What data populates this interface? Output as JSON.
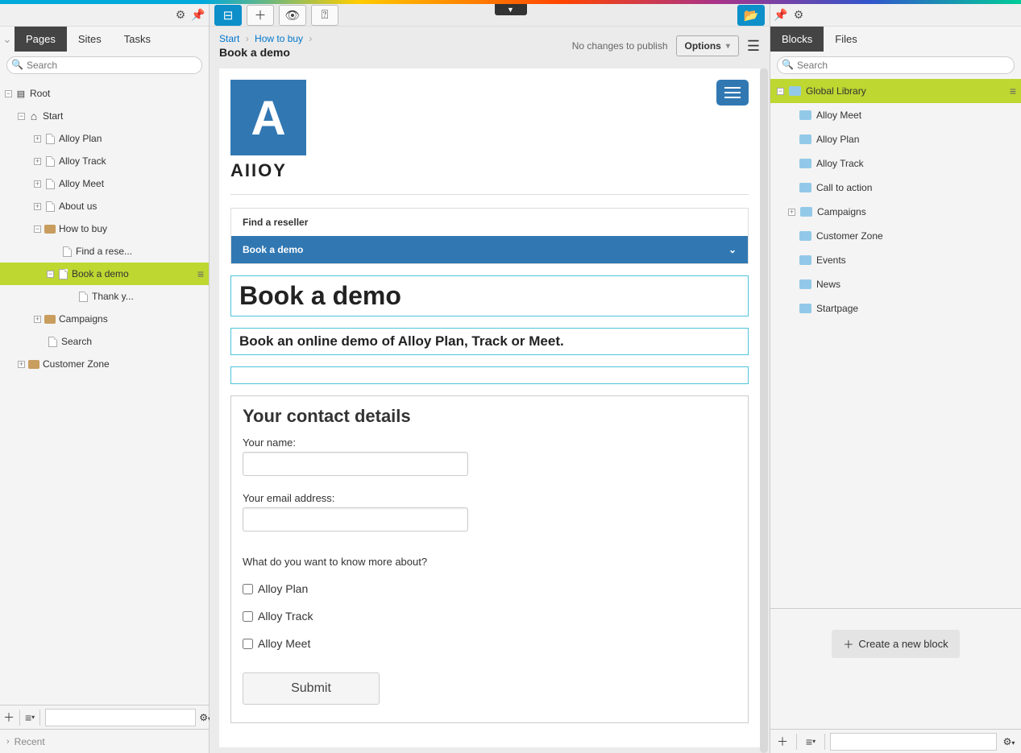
{
  "left": {
    "tabs": [
      "Pages",
      "Sites",
      "Tasks"
    ],
    "search_placeholder": "Search",
    "tree": {
      "root": "Root",
      "start": "Start",
      "alloy_plan": "Alloy Plan",
      "alloy_track": "Alloy Track",
      "alloy_meet": "Alloy Meet",
      "about_us": "About us",
      "how_to_buy": "How to buy",
      "find_reseller": "Find a rese...",
      "book_demo": "Book a demo",
      "thank_you": "Thank y...",
      "campaigns": "Campaigns",
      "search": "Search",
      "customer_zone": "Customer Zone"
    },
    "recent": "Recent"
  },
  "center": {
    "breadcrumbs": [
      "Start",
      "How to buy"
    ],
    "doc_title": "Book a demo",
    "no_changes": "No changes to publish",
    "options": "Options",
    "preview": {
      "logo_letter": "A",
      "logo_text": "AIIOY",
      "nav": {
        "find": "Find a reseller",
        "book": "Book a demo"
      },
      "h1": "Book a demo",
      "subtitle": "Book an online demo of Alloy Plan, Track or Meet.",
      "form": {
        "heading": "Your contact details",
        "name_label": "Your name:",
        "email_label": "Your email address:",
        "know_more": "What do you want to know more about?",
        "chk_plan": "Alloy Plan",
        "chk_track": "Alloy Track",
        "chk_meet": "Alloy Meet",
        "submit": "Submit"
      }
    }
  },
  "right": {
    "tabs": [
      "Blocks",
      "Files"
    ],
    "search_placeholder": "Search",
    "global": "Global Library",
    "items": {
      "alloy_meet": "Alloy Meet",
      "alloy_plan": "Alloy Plan",
      "alloy_track": "Alloy Track",
      "cta": "Call to action",
      "campaigns": "Campaigns",
      "customer_zone": "Customer Zone",
      "events": "Events",
      "news": "News",
      "startpage": "Startpage"
    },
    "create": "Create a new block"
  }
}
